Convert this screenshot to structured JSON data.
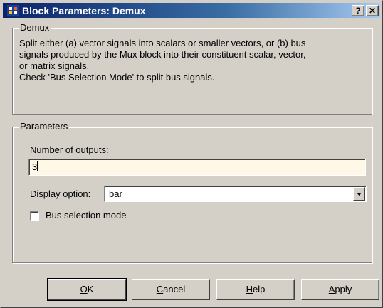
{
  "window": {
    "title": "Block Parameters: Demux",
    "help_button": "?",
    "close_button": "✕"
  },
  "demux_group": {
    "legend": "Demux",
    "description": [
      "Split either (a) vector signals into scalars or smaller vectors, or (b) bus",
      "signals produced by the Mux block into their constituent scalar, vector,",
      "or matrix signals.",
      "Check 'Bus Selection Mode' to split bus signals."
    ]
  },
  "parameters_group": {
    "legend": "Parameters",
    "number_of_outputs": {
      "label": "Number of outputs:",
      "value": "3"
    },
    "display_option": {
      "label": "Display option:",
      "value": "bar"
    },
    "bus_selection_mode": {
      "label": "Bus selection mode",
      "checked": false
    }
  },
  "buttons": {
    "ok": {
      "mnemonic": "O",
      "rest": "K"
    },
    "cancel": {
      "mnemonic": "C",
      "rest": "ancel"
    },
    "help": {
      "mnemonic": "H",
      "rest": "elp"
    },
    "apply": {
      "mnemonic": "A",
      "rest": "pply"
    }
  },
  "colors": {
    "face": "#d4d0c8",
    "title_active_start": "#0a246a",
    "title_active_end": "#a6caf0",
    "edit_field_bg": "#fff8e7"
  },
  "icons": [
    "simulink-block-icon",
    "help-icon",
    "close-icon",
    "dropdown-arrow-icon"
  ]
}
